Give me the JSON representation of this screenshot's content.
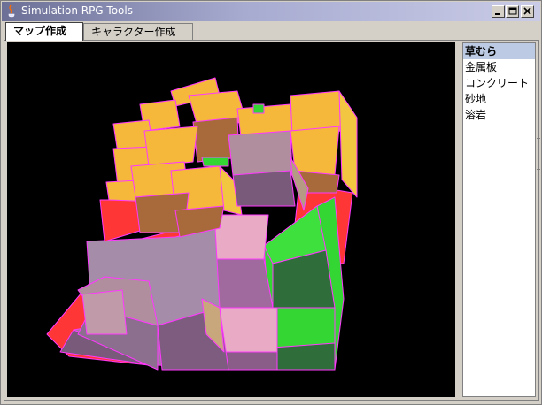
{
  "window": {
    "title": "Simulation RPG Tools",
    "controls": [
      "minimize",
      "maximize",
      "close"
    ]
  },
  "tabs": [
    {
      "label": "マップ作成",
      "active": true
    },
    {
      "label": "キャラクター作成",
      "active": false
    }
  ],
  "terrain_list": {
    "items": [
      "草むら",
      "金属板",
      "コンクリート",
      "砂地",
      "溶岩"
    ],
    "selected_index": 0
  },
  "colors": {
    "selection": "#bccbe3",
    "viewport_bg": "#000000",
    "grass": "#34d634",
    "metal": "#a6a6a6",
    "sand": "#f5b83b",
    "lava": "#ff3636",
    "tile_pink": "#e8aac4",
    "tile_mauve": "#a58ca8",
    "outline": "#ff38ff"
  }
}
